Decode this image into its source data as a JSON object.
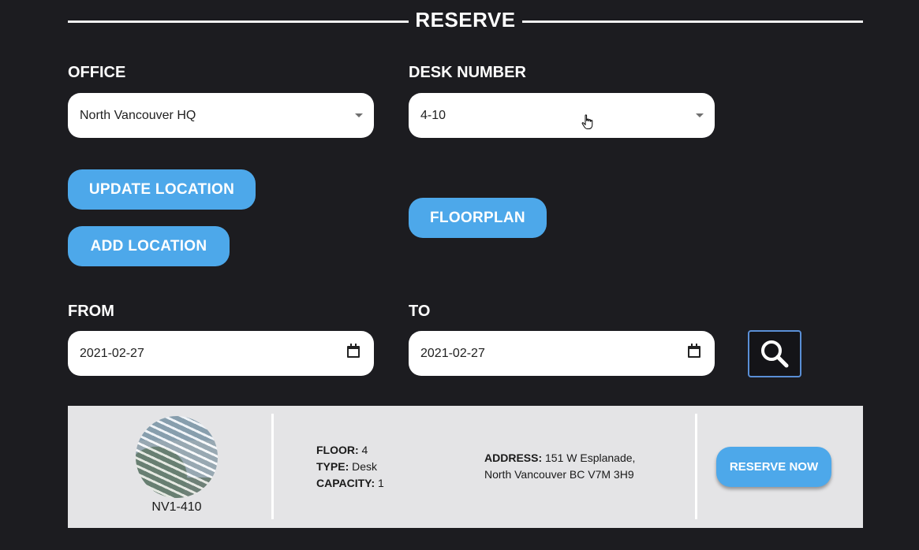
{
  "header": {
    "title": "RESERVE"
  },
  "office": {
    "label": "OFFICE",
    "value": "North Vancouver HQ"
  },
  "desk": {
    "label": "DESK NUMBER",
    "value": "4-10"
  },
  "buttons": {
    "update_location": "UPDATE LOCATION",
    "add_location": "ADD LOCATION",
    "floorplan": "FLOORPLAN"
  },
  "from": {
    "label": "FROM",
    "value": "2021-02-27"
  },
  "to": {
    "label": "TO",
    "value": "2021-02-27"
  },
  "result": {
    "desk_id": "NV1-410",
    "floor_label": "FLOOR:",
    "floor": "4",
    "type_label": "TYPE:",
    "type": "Desk",
    "capacity_label": "CAPACITY:",
    "capacity": "1",
    "address_label": "ADDRESS:",
    "address_line1": "151 W Esplanade,",
    "address_line2": "North Vancouver BC V7M 3H9",
    "reserve_label": "RESERVE NOW"
  },
  "icons": {
    "search": "search-icon",
    "calendar": "calendar-icon",
    "dropdown": "chevron-down-icon",
    "cursor": "hand-cursor-icon"
  },
  "colors": {
    "accent": "#4da8ea",
    "background": "#1c1c20",
    "card": "#e4e4e6"
  }
}
